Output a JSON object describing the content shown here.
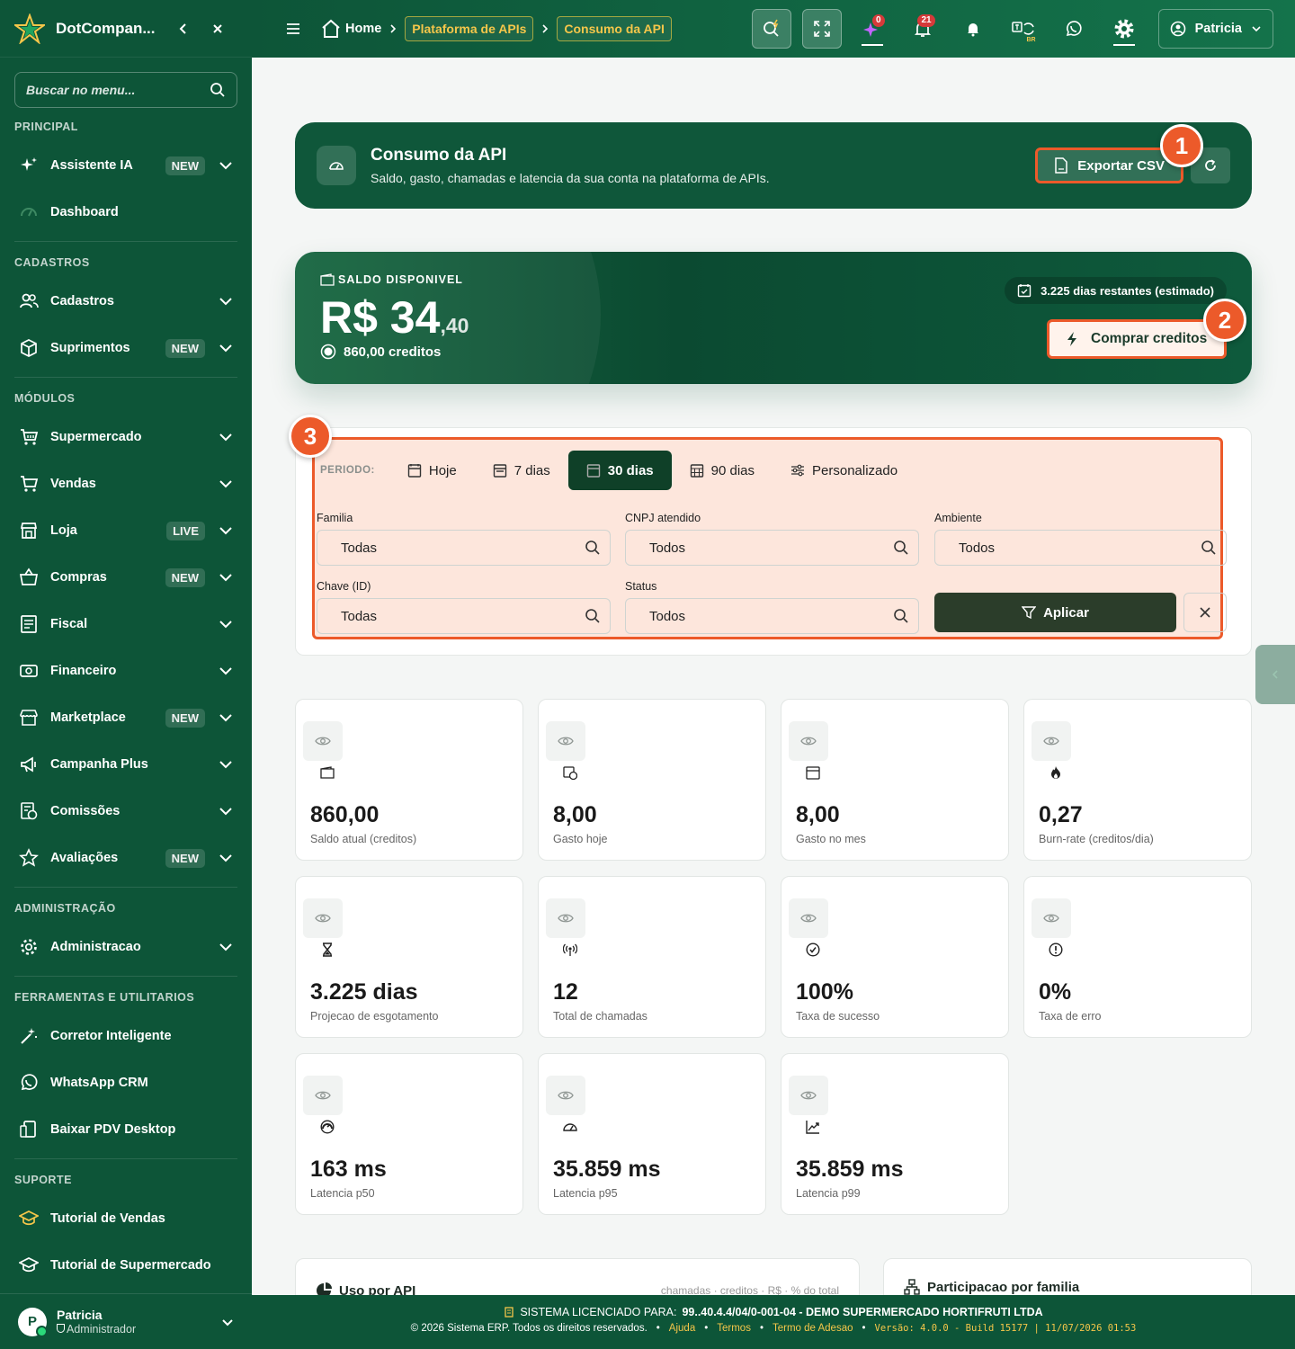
{
  "sidebar": {
    "brand": "DotCompan...",
    "search_placeholder": "Buscar no menu...",
    "sections": {
      "principal": "PRINCIPAL",
      "cadastros": "CADASTROS",
      "modulos": "MÓDULOS",
      "administracao": "ADMINISTRAÇÃO",
      "ferramentas": "FERRAMENTAS E UTILITARIOS",
      "suporte": "SUPORTE"
    },
    "items": {
      "assistente": {
        "label": "Assistente IA",
        "badge": "NEW"
      },
      "dashboard": {
        "label": "Dashboard"
      },
      "cadastros": {
        "label": "Cadastros"
      },
      "suprimentos": {
        "label": "Suprimentos",
        "badge": "NEW"
      },
      "supermercado": {
        "label": "Supermercado"
      },
      "vendas": {
        "label": "Vendas"
      },
      "loja": {
        "label": "Loja",
        "badge": "LIVE"
      },
      "compras": {
        "label": "Compras",
        "badge": "NEW"
      },
      "fiscal": {
        "label": "Fiscal"
      },
      "financeiro": {
        "label": "Financeiro"
      },
      "marketplace": {
        "label": "Marketplace",
        "badge": "NEW"
      },
      "campanha": {
        "label": "Campanha Plus"
      },
      "comissoes": {
        "label": "Comissões"
      },
      "avaliacoes": {
        "label": "Avaliações",
        "badge": "NEW"
      },
      "administracao": {
        "label": "Administracao"
      },
      "corretor": {
        "label": "Corretor Inteligente"
      },
      "whatsapp": {
        "label": "WhatsApp CRM"
      },
      "pdv": {
        "label": "Baixar PDV Desktop"
      },
      "tut_vendas": {
        "label": "Tutorial de Vendas"
      },
      "tut_super": {
        "label": "Tutorial de Supermercado"
      }
    },
    "user": {
      "initial": "P",
      "name": "Patricia",
      "role": "Administrador"
    }
  },
  "topbar": {
    "home": "Home",
    "crumb1": "Plataforma de APIs",
    "crumb2": "Consumo da API",
    "badge_ai": "0",
    "badge_notif": "21",
    "lang_tag": "BR",
    "user": "Patricia"
  },
  "hero": {
    "title": "Consumo da API",
    "subtitle": "Saldo, gasto, chamadas e latencia da sua conta na plataforma de APIs.",
    "export_label": "Exportar CSV"
  },
  "markers": [
    "1",
    "2",
    "3"
  ],
  "balance": {
    "label": "SALDO DISPONIVEL",
    "amount_main": "R$ 34",
    "amount_cents": ",40",
    "credits": "860,00 creditos",
    "days_left": "3.225 dias restantes (estimado)",
    "buy_label": "Comprar creditos"
  },
  "filters": {
    "period_label": "PERIODO:",
    "periods": [
      "Hoje",
      "7 dias",
      "30 dias",
      "90 dias",
      "Personalizado"
    ],
    "active_period": "30 dias",
    "familia": {
      "label": "Familia",
      "value": "Todas"
    },
    "cnpj": {
      "label": "CNPJ atendido",
      "value": "Todos"
    },
    "ambiente": {
      "label": "Ambiente",
      "value": "Todos"
    },
    "chave": {
      "label": "Chave (ID)",
      "value": "Todas"
    },
    "status": {
      "label": "Status",
      "value": "Todos"
    },
    "apply_label": "Aplicar"
  },
  "kpis": [
    {
      "value": "860,00",
      "label": "Saldo atual (creditos)",
      "icon": "wallet-icon"
    },
    {
      "value": "8,00",
      "label": "Gasto hoje",
      "icon": "money-calendar-icon"
    },
    {
      "value": "8,00",
      "label": "Gasto no mes",
      "icon": "calendar-month-icon"
    },
    {
      "value": "0,27",
      "label": "Burn-rate (creditos/dia)",
      "icon": "fire-icon"
    },
    {
      "value": "3.225 dias",
      "label": "Projecao de esgotamento",
      "icon": "hourglass-icon"
    },
    {
      "value": "12",
      "label": "Total de chamadas",
      "icon": "antenna-icon"
    },
    {
      "value": "100%",
      "label": "Taxa de sucesso",
      "icon": "check-circle-icon"
    },
    {
      "value": "0%",
      "label": "Taxa de erro",
      "icon": "alert-circle-icon"
    },
    {
      "value": "163 ms",
      "label": "Latencia p50",
      "icon": "gauge-icon"
    },
    {
      "value": "35.859 ms",
      "label": "Latencia p95",
      "icon": "gauge-high-icon"
    },
    {
      "value": "35.859 ms",
      "label": "Latencia p99",
      "icon": "trend-icon"
    }
  ],
  "bottom": {
    "uso_title": "Uso por API",
    "uso_meta": "chamadas · creditos · R$ · % do total",
    "part_title": "Participacao por familia"
  },
  "footer": {
    "license_prefix": "SISTEMA LICENCIADO PARA:",
    "license_value": "99..40.4.4/04/0-001-04 - DEMO SUPERMERCADO HORTIFRUTI LTDA",
    "copyright": "© 2026 Sistema ERP. Todos os direitos reservados.",
    "links": [
      "Ajuda",
      "Termos",
      "Termo de Adesao"
    ],
    "version": "Versão: 4.0.0 - Build 15177 | 11/07/2026 01:53"
  },
  "colors": {
    "brand": "#0d5538",
    "accent": "#ec5a2a",
    "gold": "#f5c64a"
  }
}
